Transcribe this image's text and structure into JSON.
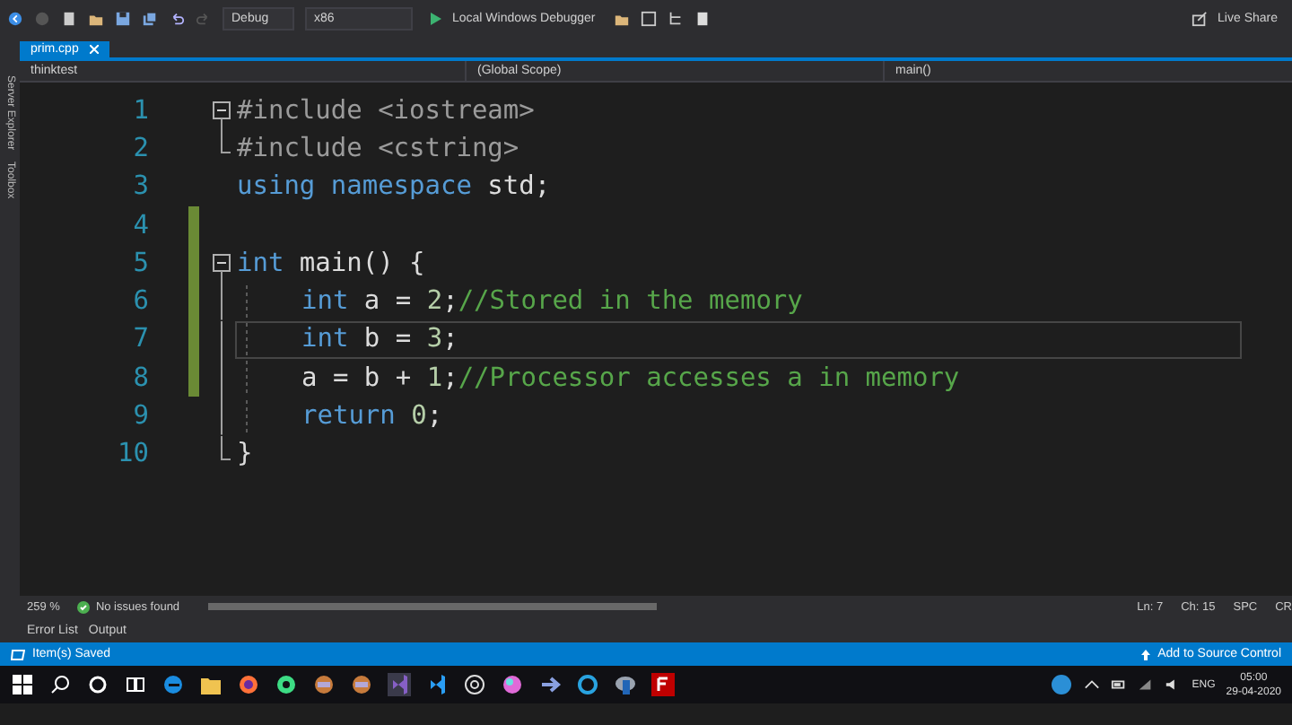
{
  "toolbar": {
    "configuration": "Debug",
    "platform": "x86",
    "run_target": "Local Windows Debugger",
    "live_share": "Live Share"
  },
  "side_tabs": [
    "Server Explorer",
    "Toolbox"
  ],
  "tabs": [
    {
      "label": "prim.cpp",
      "selected": true
    }
  ],
  "navigation": {
    "project": "thinktest",
    "scope": "(Global Scope)",
    "member": "main()"
  },
  "code_lines": [
    {
      "number": "1",
      "kind": "fold-start",
      "changed": false,
      "current": false,
      "indented": false,
      "tokens": [
        {
          "kind": "pre",
          "text": "#include <iostream>"
        }
      ]
    },
    {
      "number": "2",
      "kind": "fold-end",
      "changed": false,
      "current": false,
      "indented": false,
      "tokens": [
        {
          "kind": "pre",
          "text": "#include <cstring>"
        }
      ]
    },
    {
      "number": "3",
      "kind": "plain",
      "changed": false,
      "current": false,
      "indented": false,
      "tokens": [
        {
          "kind": "keyword",
          "text": "using namespace"
        },
        {
          "kind": "plain",
          "text": " std;"
        }
      ]
    },
    {
      "number": "4",
      "kind": "plain",
      "changed": true,
      "current": false,
      "indented": false
    },
    {
      "number": "5",
      "kind": "fold-start",
      "changed": true,
      "current": false,
      "indented": false,
      "tokens": [
        {
          "kind": "keyword",
          "text": "int"
        },
        {
          "kind": "plain",
          "text": " main() {"
        }
      ]
    },
    {
      "number": "6",
      "kind": "fold-body",
      "changed": true,
      "current": false,
      "indented": true,
      "tokens": [
        {
          "kind": "keyword",
          "text": "int"
        },
        {
          "kind": "plain",
          "text": " a = "
        },
        {
          "kind": "number",
          "text": "2"
        },
        {
          "kind": "plain",
          "text": ";"
        },
        {
          "kind": "comment",
          "text": "//Stored in the memory"
        }
      ]
    },
    {
      "number": "7",
      "kind": "fold-body",
      "changed": true,
      "current": true,
      "indented": true,
      "tokens": [
        {
          "kind": "keyword",
          "text": "int"
        },
        {
          "kind": "plain",
          "text": " b = "
        },
        {
          "kind": "number",
          "text": "3"
        },
        {
          "kind": "plain",
          "text": ";"
        }
      ]
    },
    {
      "number": "8",
      "kind": "fold-body",
      "changed": true,
      "current": false,
      "indented": true,
      "tokens": [
        {
          "kind": "plain",
          "text": "a = b + "
        },
        {
          "kind": "number",
          "text": "1"
        },
        {
          "kind": "plain",
          "text": ";"
        },
        {
          "kind": "comment",
          "text": "//Processor accesses a in memory"
        }
      ]
    },
    {
      "number": "9",
      "kind": "fold-body",
      "changed": false,
      "current": false,
      "indented": true,
      "tokens": [
        {
          "kind": "keyword",
          "text": "return "
        },
        {
          "kind": "number",
          "text": "0"
        },
        {
          "kind": "plain",
          "text": ";"
        }
      ]
    },
    {
      "number": "10",
      "kind": "fold-end",
      "changed": false,
      "current": false,
      "indented": false,
      "tokens": [
        {
          "kind": "plain",
          "text": "}"
        }
      ]
    }
  ],
  "editor_status": {
    "zoom": "259 %",
    "issues": "No issues found",
    "line": "Ln: 7",
    "column": "Ch: 15",
    "whitespace": "SPC",
    "line_ending": "CR"
  },
  "tool_tabs": [
    "Error List",
    "Output"
  ],
  "status_bar": {
    "message": "Item(s) Saved",
    "source_control": "Add to Source Control"
  },
  "taskbar": {
    "language": "ENG",
    "time": "05:00",
    "date": "29-04-2020"
  }
}
